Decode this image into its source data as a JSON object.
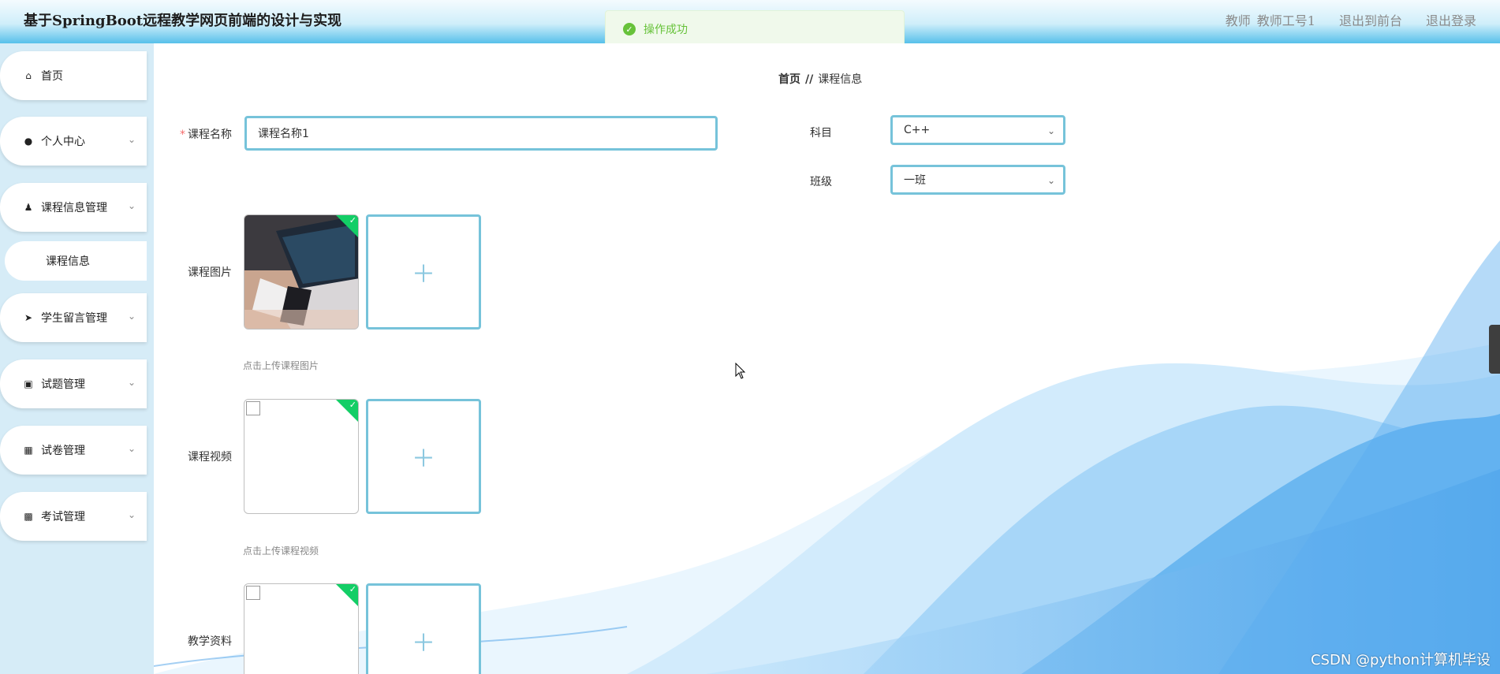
{
  "app": {
    "title": "基于SpringBoot远程教学网页前端的设计与实现"
  },
  "header": {
    "role": "教师",
    "user": "教师工号1",
    "to_front": "退出到前台",
    "logout": "退出登录"
  },
  "toast": {
    "message": "操作成功",
    "icon": "success-check-icon"
  },
  "sidebar": {
    "items": [
      {
        "label": "首页",
        "icon": "home-icon"
      },
      {
        "label": "个人中心",
        "icon": "user-icon"
      },
      {
        "label": "课程信息管理",
        "icon": "user-tie-icon"
      },
      {
        "label": "课程信息",
        "icon": ""
      },
      {
        "label": "学生留言管理",
        "icon": "send-icon"
      },
      {
        "label": "试题管理",
        "icon": "clipboard-icon"
      },
      {
        "label": "试卷管理",
        "icon": "grid-icon"
      },
      {
        "label": "考试管理",
        "icon": "apps-icon"
      }
    ]
  },
  "breadcrumb": {
    "home": "首页",
    "separator": "//",
    "current": "课程信息"
  },
  "form": {
    "course_name_label": "课程名称",
    "course_name_value": "课程名称1",
    "subject_label": "科目",
    "subject_value": "C++",
    "class_label": "班级",
    "class_value": "一班",
    "image_label": "课程图片",
    "image_hint": "点击上传课程图片",
    "video_label": "课程视频",
    "video_hint": "点击上传课程视频",
    "material_label": "教学资料"
  },
  "watermark": "CSDN @python计算机毕设",
  "colors": {
    "accent": "#76c3da",
    "success": "#67c23a",
    "badge": "#13ce66"
  }
}
